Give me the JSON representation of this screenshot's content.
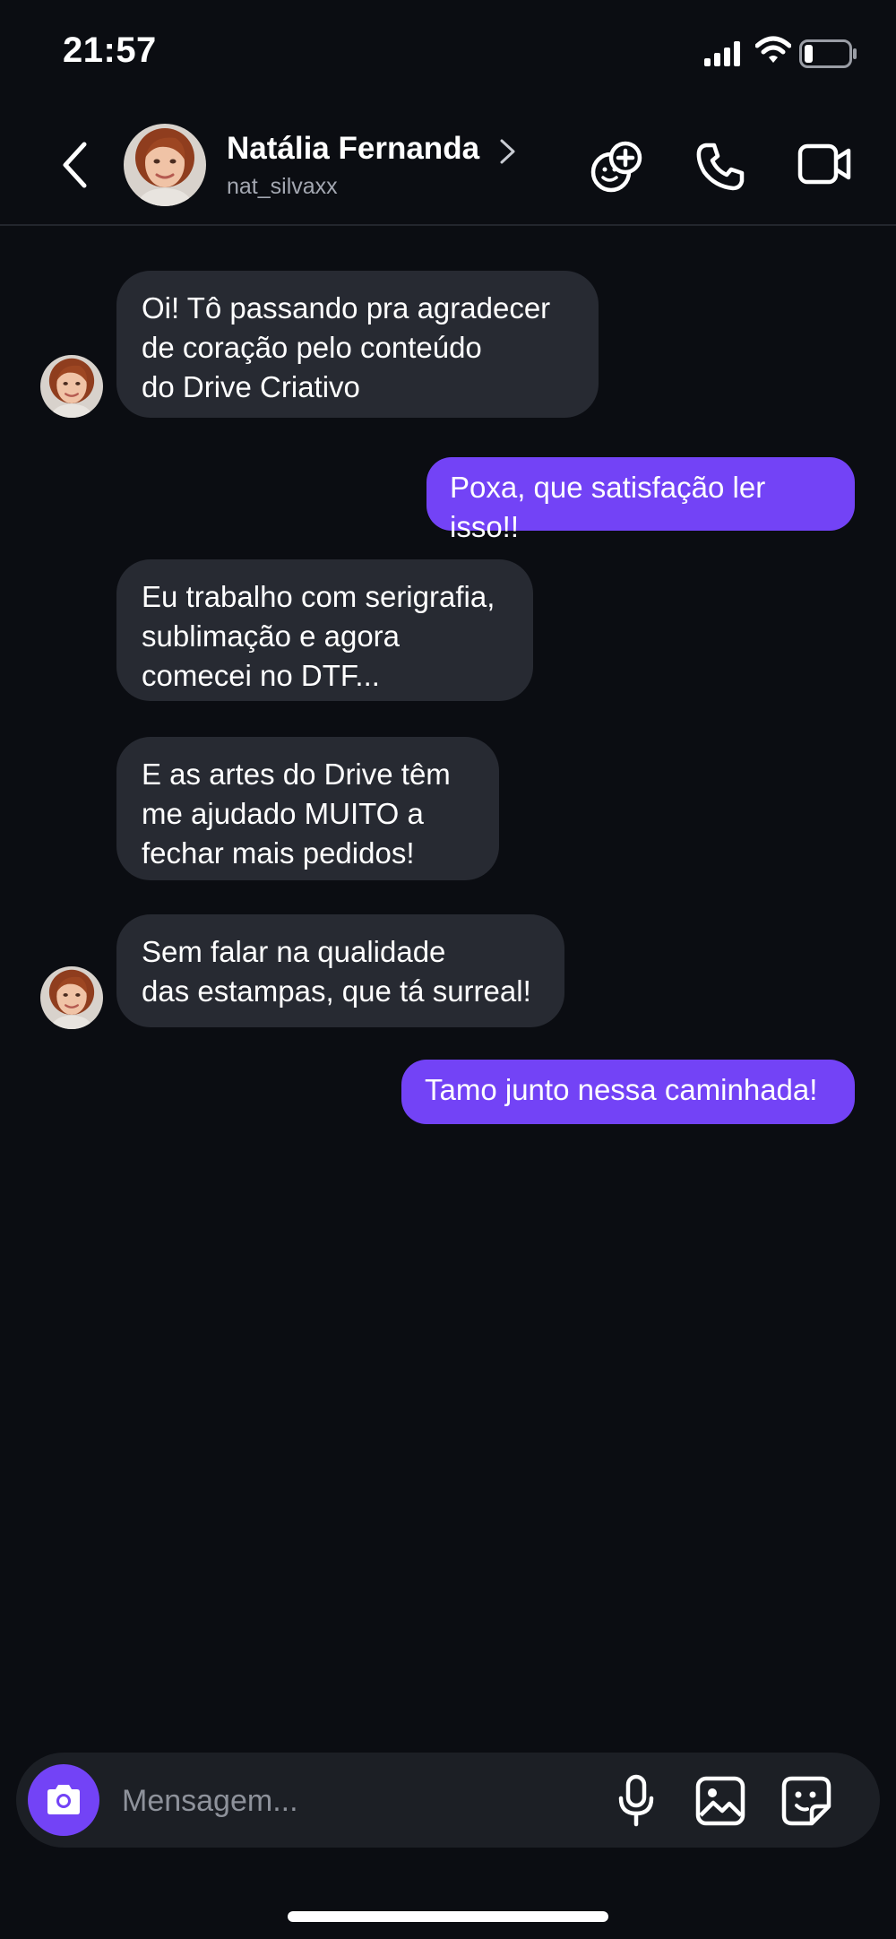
{
  "status_bar": {
    "time": "21:57",
    "signal_icon": "signal-icon",
    "wifi_icon": "wifi-icon",
    "battery_icon": "battery-icon",
    "battery_level": 0.15
  },
  "header": {
    "back_icon": "chevron-left-icon",
    "contact_name": "Natália Fernanda",
    "username": "nat_silvaxx",
    "actions": [
      "add-friend-icon",
      "phone-icon",
      "video-camera-icon"
    ]
  },
  "messages": [
    {
      "direction": "incoming",
      "text": "Oi! Tô passando pra agradecer\nde coração pelo conteúdo\ndo Drive Criativo",
      "avatar": true
    },
    {
      "direction": "outgoing",
      "text": "Poxa, que satisfação ler isso!!"
    },
    {
      "direction": "incoming",
      "text": "Eu trabalho com serigrafia,\nsublimação e agora\ncomecei no DTF...",
      "avatar": false
    },
    {
      "direction": "incoming",
      "text": "E as artes do Drive têm\nme ajudado MUITO a\nfechar mais pedidos!",
      "avatar": false
    },
    {
      "direction": "incoming",
      "text": "Sem falar na qualidade\ndas estampas, que tá surreal!",
      "avatar": true
    },
    {
      "direction": "outgoing",
      "text": "Tamo junto nessa caminhada!"
    }
  ],
  "composer": {
    "placeholder": "Mensagem...",
    "camera_icon": "camera-icon",
    "mic_icon": "microphone-icon",
    "gallery_icon": "image-icon",
    "sticker_icon": "sticker-icon"
  },
  "colors": {
    "background": "#0b0d12",
    "incoming_bubble": "#272a32",
    "outgoing_bubble": "#7343f6",
    "accent": "#7343f6"
  }
}
